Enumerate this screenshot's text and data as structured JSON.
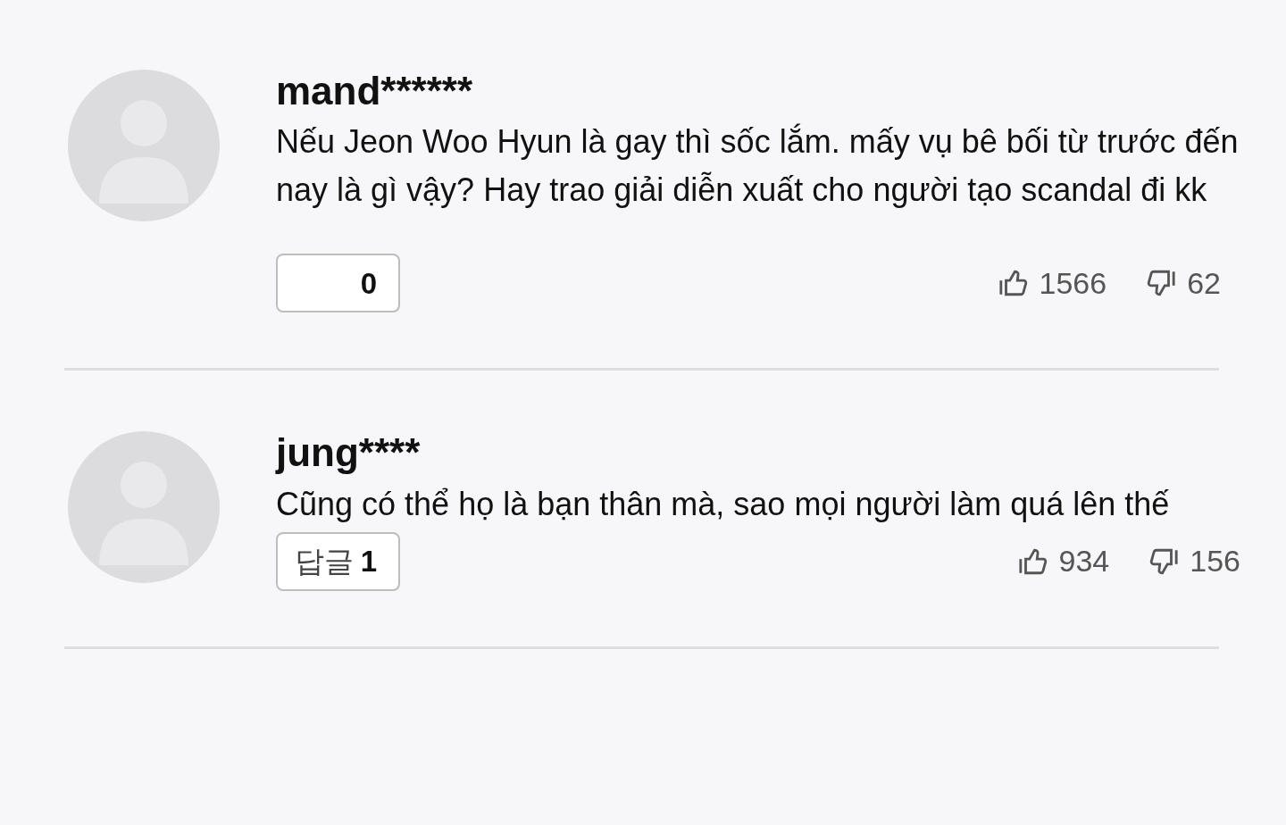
{
  "comments": [
    {
      "username": "mand******",
      "text": "Nếu Jeon Woo Hyun là gay thì sốc lắm. mấy vụ bê bối từ trước đến nay là gì vậy? Hay trao giải diễn xuất cho người tạo scandal đi kk",
      "reply_button": {
        "count": "0"
      },
      "likes": "1566",
      "dislikes": "62"
    },
    {
      "username": "jung****",
      "text": "Cũng có thể họ là bạn thân mà, sao mọi người làm quá lên thế",
      "reply_button": {
        "label": "답글",
        "count": "1"
      },
      "likes": "934",
      "dislikes": "156"
    }
  ]
}
